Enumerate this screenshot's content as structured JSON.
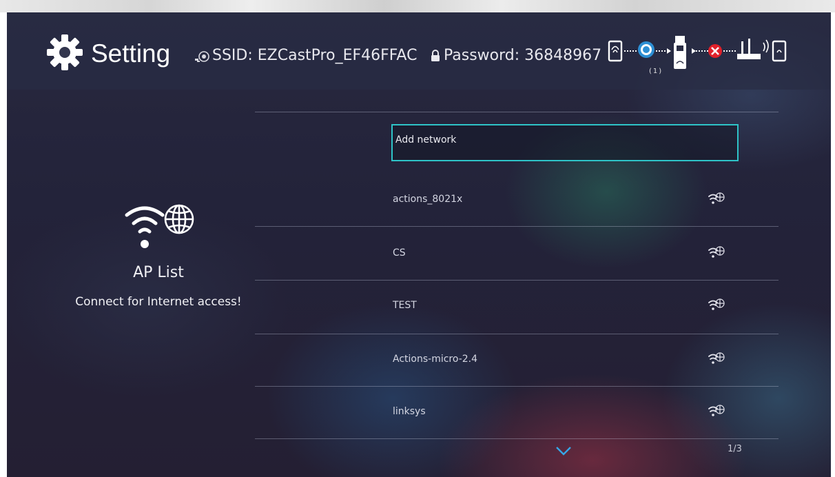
{
  "header": {
    "title": "Setting",
    "ssid": "SSID: EZCastPro_EF46FFAC",
    "password": "Password: 36848967",
    "connection_count": "(1)",
    "icons": [
      "gear-icon",
      "ssid-icon",
      "lock-icon",
      "phone-icon",
      "cast-icon",
      "dongle-icon",
      "disconnected-icon",
      "router-icon"
    ]
  },
  "left_panel": {
    "title": "AP List",
    "subtitle": "Connect for Internet access!"
  },
  "networks": {
    "add_label": "Add network",
    "items": [
      {
        "name": "actions_8021x"
      },
      {
        "name": "CS"
      },
      {
        "name": "TEST"
      },
      {
        "name": "Actions-micro-2.4"
      },
      {
        "name": "linksys"
      }
    ]
  },
  "pagination": {
    "page": "1/3"
  },
  "colors": {
    "focus": "#2ec4c8",
    "error": "#e0202a"
  }
}
